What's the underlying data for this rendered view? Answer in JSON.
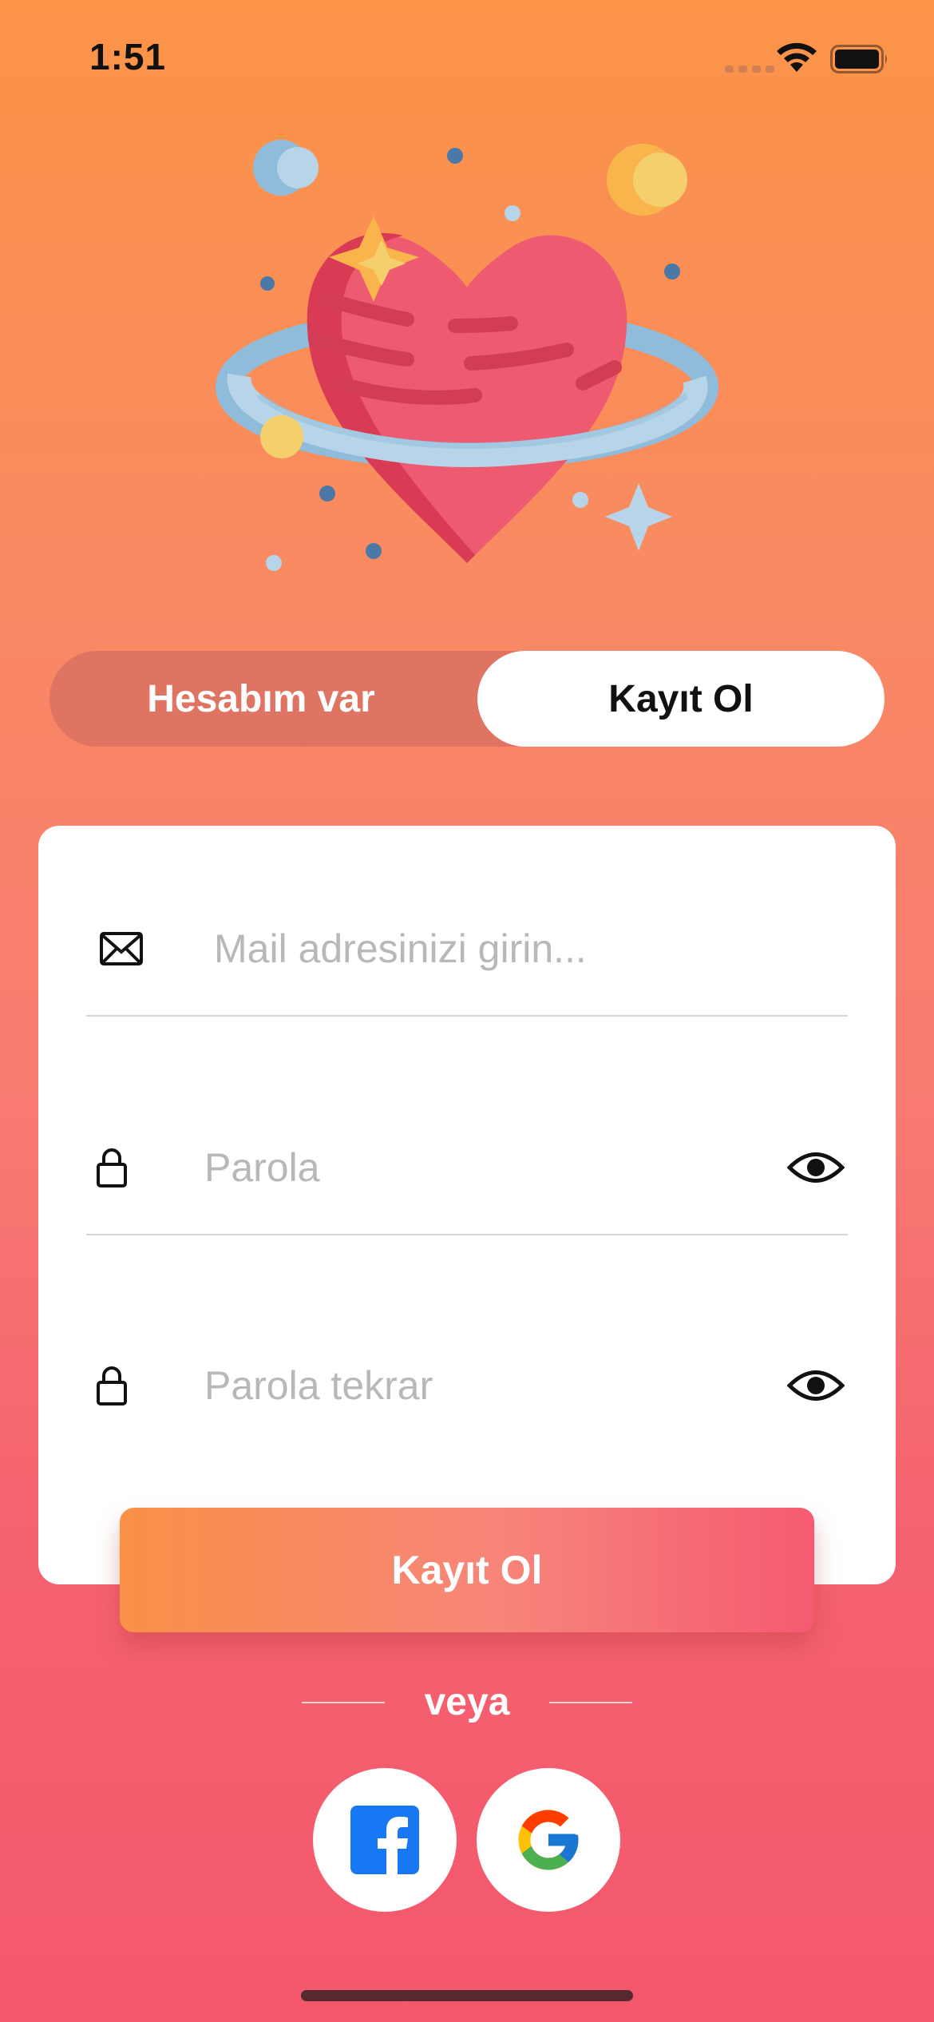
{
  "status_bar": {
    "time": "1:51"
  },
  "tabs": {
    "left_label": "Hesabım var",
    "right_label": "Kayıt Ol",
    "active": "right"
  },
  "form": {
    "email_placeholder": "Mail adresinizi girin...",
    "password_placeholder": "Parola",
    "password_repeat_placeholder": "Parola tekrar"
  },
  "submit_label": "Kayıt Ol",
  "divider_label": "veya",
  "social_buttons": [
    {
      "icon": "facebook-icon",
      "color": "#1877f2"
    },
    {
      "icon": "google-icon"
    }
  ],
  "colors": {
    "gradient_top": "#fb9447",
    "gradient_bottom": "#f4576d",
    "segment_bg": "#e07462"
  }
}
